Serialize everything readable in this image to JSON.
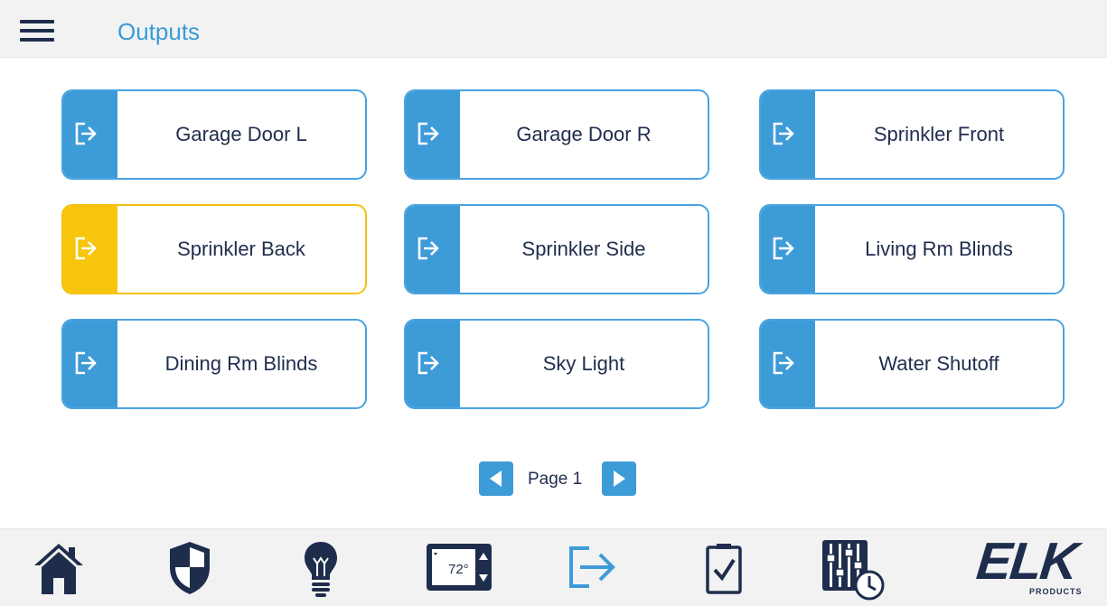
{
  "header": {
    "title": "Outputs"
  },
  "outputs": [
    {
      "label": "Garage Door L",
      "active": false
    },
    {
      "label": "Garage Door R",
      "active": false
    },
    {
      "label": "Sprinkler Front",
      "active": false
    },
    {
      "label": "Sprinkler Back",
      "active": true
    },
    {
      "label": "Sprinkler Side",
      "active": false
    },
    {
      "label": "Living Rm Blinds",
      "active": false
    },
    {
      "label": "Dining Rm Blinds",
      "active": false
    },
    {
      "label": "Sky Light",
      "active": false
    },
    {
      "label": "Water Shutoff",
      "active": false
    }
  ],
  "pager": {
    "label": "Page 1"
  },
  "footer": {
    "thermostat_value": "72°",
    "brand": "ELK",
    "brand_sub": "PRODUCTS"
  },
  "colors": {
    "accent": "#3d9bd8",
    "active": "#f7c50b",
    "navy": "#1f2d4d"
  },
  "icons": [
    "menu-icon",
    "output-arrow-icon",
    "chevron-left-icon",
    "chevron-right-icon",
    "home-icon",
    "shield-icon",
    "lightbulb-icon",
    "thermostat-icon",
    "outputs-icon",
    "task-checklist-icon",
    "automation-sliders-clock-icon",
    "elk-logo"
  ]
}
